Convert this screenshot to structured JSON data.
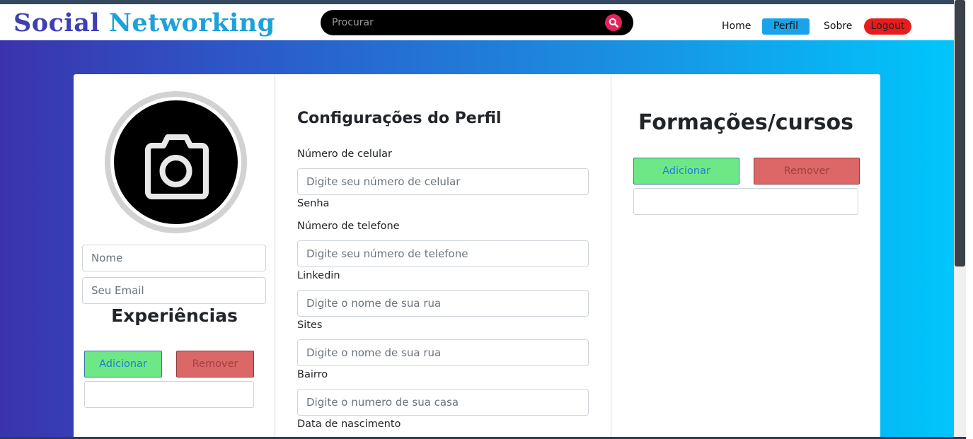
{
  "navbar": {
    "brand_part1": "Social",
    "brand_part2": "Networking",
    "search_placeholder": "Procurar",
    "links": [
      "Home",
      "Perfil",
      "Sobre",
      "Logout"
    ]
  },
  "colors": {
    "brand_dark": "#3f3fb5",
    "brand_light": "#1da1db",
    "active_tab": "#1aa3e8",
    "logout": "#e81c1c",
    "search_button": "#e0245e",
    "add_button": "#6ee887",
    "remove_button": "#dc6767"
  },
  "profile": {
    "avatar_icon": "camera-icon",
    "name_placeholder": "Nome",
    "email_placeholder": "Seu Email",
    "experiences_title": "Experiências",
    "add_label": "Adicionar",
    "remove_label": "Remover"
  },
  "settings": {
    "title": "Configurações do Perfil",
    "fields": [
      {
        "label": "Número de celular",
        "placeholder": "Digite seu número de celular"
      },
      {
        "label": "Senha",
        "placeholder": null
      },
      {
        "label": "Número de telefone",
        "placeholder": "Digite seu número de telefone"
      },
      {
        "label": "Linkedin",
        "placeholder": "Digite o nome de sua rua"
      },
      {
        "label": "Sites",
        "placeholder": "Digite o nome de sua rua"
      },
      {
        "label": "Bairro",
        "placeholder": "Digite o numero de sua casa"
      },
      {
        "label": "Data de nascimento",
        "placeholder": null
      }
    ]
  },
  "courses": {
    "title": "Formações/cursos",
    "add_label": "Adicionar",
    "remove_label": "Remover"
  }
}
